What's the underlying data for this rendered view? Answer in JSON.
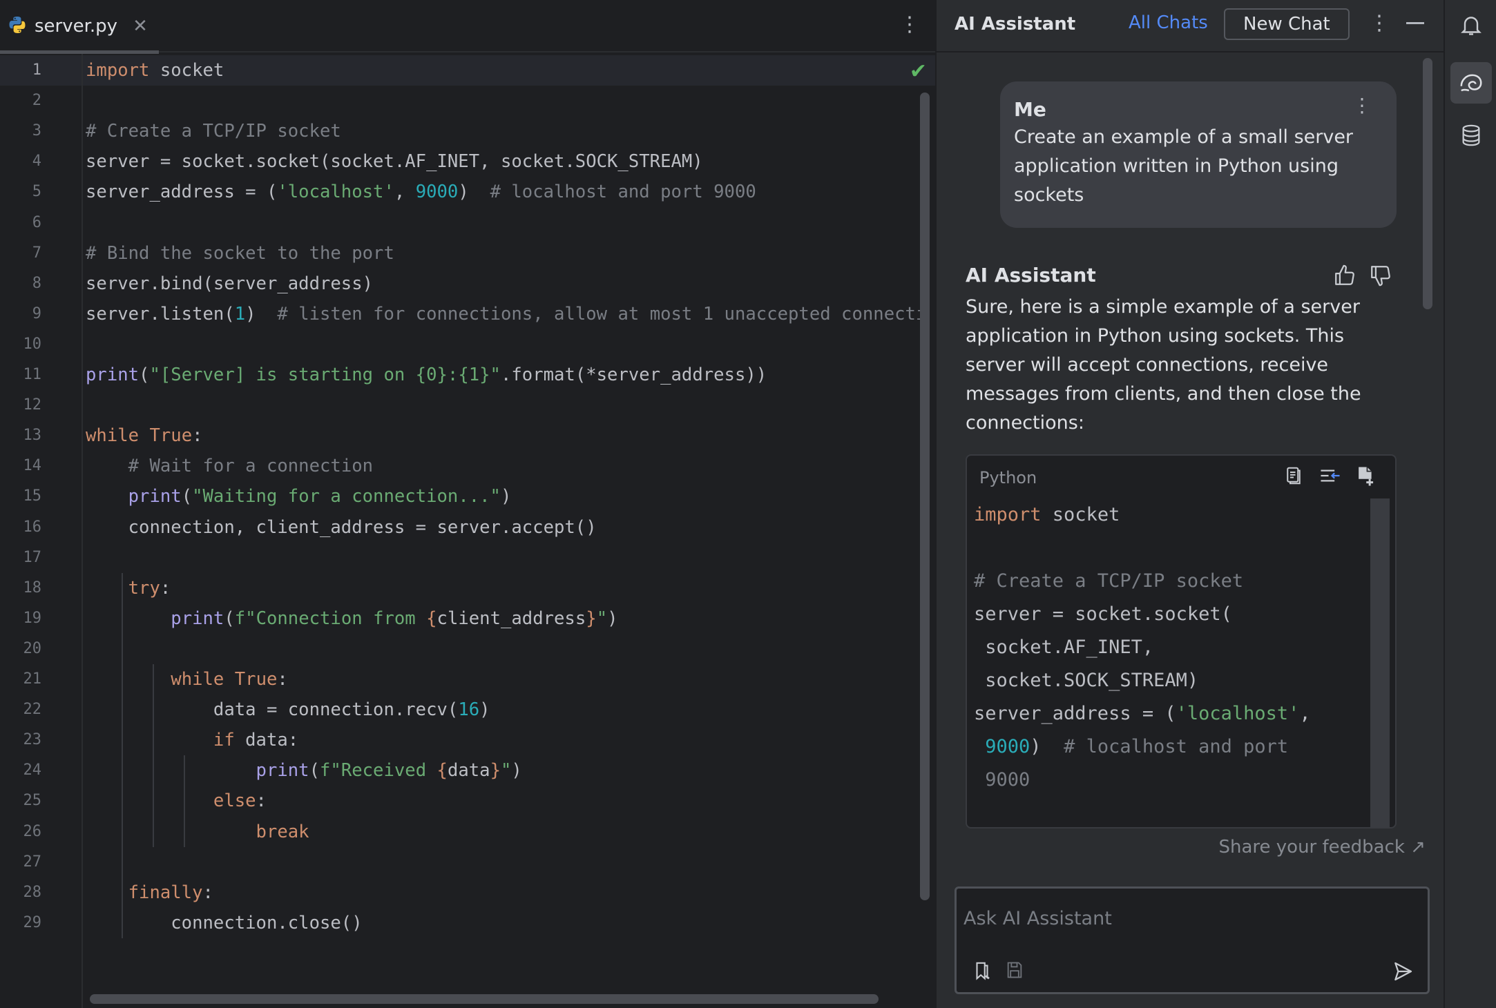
{
  "editor": {
    "tab": {
      "filename": "server.py",
      "close": "✕"
    },
    "menu_glyph": "⋮",
    "check_glyph": "✔",
    "current_line": "1",
    "lines": [
      {
        "n": "1",
        "tokens": [
          {
            "t": "import",
            "c": "kw"
          },
          {
            "t": " socket"
          }
        ]
      },
      {
        "n": "2",
        "tokens": []
      },
      {
        "n": "3",
        "tokens": [
          {
            "t": "# Create a TCP/IP socket",
            "c": "cm"
          }
        ]
      },
      {
        "n": "4",
        "tokens": [
          {
            "t": "server = socket.socket(socket.AF_INET, socket.SOCK_STREAM)"
          }
        ]
      },
      {
        "n": "5",
        "tokens": [
          {
            "t": "server_address = ("
          },
          {
            "t": "'localhost'",
            "c": "str"
          },
          {
            "t": ", "
          },
          {
            "t": "9000",
            "c": "num"
          },
          {
            "t": ")  "
          },
          {
            "t": "# localhost and port 9000",
            "c": "cm"
          }
        ]
      },
      {
        "n": "6",
        "tokens": []
      },
      {
        "n": "7",
        "tokens": [
          {
            "t": "# Bind the socket to the port",
            "c": "cm"
          }
        ]
      },
      {
        "n": "8",
        "tokens": [
          {
            "t": "server.bind(server_address)"
          }
        ]
      },
      {
        "n": "9",
        "tokens": [
          {
            "t": "server.listen("
          },
          {
            "t": "1",
            "c": "num"
          },
          {
            "t": ")  "
          },
          {
            "t": "# listen for connections, allow at most 1 unaccepted connecti",
            "c": "cm"
          }
        ]
      },
      {
        "n": "10",
        "tokens": []
      },
      {
        "n": "11",
        "tokens": [
          {
            "t": "print",
            "c": "bi"
          },
          {
            "t": "("
          },
          {
            "t": "\"[Server] is starting on {0}:{1}\"",
            "c": "str"
          },
          {
            "t": ".format(*server_address))"
          }
        ]
      },
      {
        "n": "12",
        "tokens": []
      },
      {
        "n": "13",
        "tokens": [
          {
            "t": "while",
            "c": "kw"
          },
          {
            "t": " "
          },
          {
            "t": "True",
            "c": "kw"
          },
          {
            "t": ":"
          }
        ]
      },
      {
        "n": "14",
        "tokens": [
          {
            "t": "    "
          },
          {
            "t": "# Wait for a connection",
            "c": "cm"
          }
        ]
      },
      {
        "n": "15",
        "tokens": [
          {
            "t": "    "
          },
          {
            "t": "print",
            "c": "bi"
          },
          {
            "t": "("
          },
          {
            "t": "\"Waiting for a connection...\"",
            "c": "str"
          },
          {
            "t": ")"
          }
        ]
      },
      {
        "n": "16",
        "tokens": [
          {
            "t": "    connection, client_address = server.accept()"
          }
        ]
      },
      {
        "n": "17",
        "tokens": []
      },
      {
        "n": "18",
        "tokens": [
          {
            "t": "    "
          },
          {
            "t": "try",
            "c": "kw"
          },
          {
            "t": ":"
          }
        ]
      },
      {
        "n": "19",
        "tokens": [
          {
            "t": "        "
          },
          {
            "t": "print",
            "c": "bi"
          },
          {
            "t": "("
          },
          {
            "t": "f\"Connection from ",
            "c": "str"
          },
          {
            "t": "{",
            "c": "kw"
          },
          {
            "t": "client_address"
          },
          {
            "t": "}",
            "c": "kw"
          },
          {
            "t": "\"",
            "c": "str"
          },
          {
            "t": ")"
          }
        ]
      },
      {
        "n": "20",
        "tokens": []
      },
      {
        "n": "21",
        "tokens": [
          {
            "t": "        "
          },
          {
            "t": "while",
            "c": "kw"
          },
          {
            "t": " "
          },
          {
            "t": "True",
            "c": "kw"
          },
          {
            "t": ":"
          }
        ]
      },
      {
        "n": "22",
        "tokens": [
          {
            "t": "            data = connection.recv("
          },
          {
            "t": "16",
            "c": "num"
          },
          {
            "t": ")"
          }
        ]
      },
      {
        "n": "23",
        "tokens": [
          {
            "t": "            "
          },
          {
            "t": "if",
            "c": "kw"
          },
          {
            "t": " data:"
          }
        ]
      },
      {
        "n": "24",
        "tokens": [
          {
            "t": "                "
          },
          {
            "t": "print",
            "c": "bi"
          },
          {
            "t": "("
          },
          {
            "t": "f\"Received ",
            "c": "str"
          },
          {
            "t": "{",
            "c": "kw"
          },
          {
            "t": "data"
          },
          {
            "t": "}",
            "c": "kw"
          },
          {
            "t": "\"",
            "c": "str"
          },
          {
            "t": ")"
          }
        ]
      },
      {
        "n": "25",
        "tokens": [
          {
            "t": "            "
          },
          {
            "t": "else",
            "c": "kw"
          },
          {
            "t": ":"
          }
        ]
      },
      {
        "n": "26",
        "tokens": [
          {
            "t": "                "
          },
          {
            "t": "break",
            "c": "kw"
          }
        ]
      },
      {
        "n": "27",
        "tokens": []
      },
      {
        "n": "28",
        "tokens": [
          {
            "t": "    "
          },
          {
            "t": "finally",
            "c": "kw"
          },
          {
            "t": ":"
          }
        ]
      },
      {
        "n": "29",
        "tokens": [
          {
            "t": "        connection.close()"
          }
        ]
      }
    ]
  },
  "ai": {
    "title": "AI Assistant",
    "all_chats": "All Chats",
    "new_chat": "New Chat",
    "menu_glyph": "⋮",
    "me": {
      "name": "Me",
      "text": "Create an example of a small server application written in Python using sockets"
    },
    "response": {
      "name": "AI Assistant",
      "text": "Sure, here is a simple example of a server application in Python using sockets. This server will accept connections, receive messages from clients, and then close the connections:"
    },
    "code_block": {
      "language": "Python",
      "lines": [
        [
          {
            "t": "import",
            "c": "kw"
          },
          {
            "t": " socket"
          }
        ],
        [],
        [
          {
            "t": "# Create a TCP/IP socket",
            "c": "cm"
          }
        ],
        [
          {
            "t": "server = socket.socket("
          }
        ],
        [
          {
            "t": " socket.AF_INET,"
          }
        ],
        [
          {
            "t": " socket.SOCK_STREAM)"
          }
        ],
        [
          {
            "t": "server_address = ("
          },
          {
            "t": "'localhost'",
            "c": "str"
          },
          {
            "t": ","
          }
        ],
        [
          {
            "t": " "
          },
          {
            "t": "9000",
            "c": "num"
          },
          {
            "t": ")  "
          },
          {
            "t": "# localhost and port",
            "c": "cm"
          }
        ],
        [
          {
            "t": " 9000",
            "c": "cm"
          }
        ]
      ]
    },
    "feedback": "Share your feedback ↗",
    "input_placeholder": "Ask AI Assistant"
  },
  "colors": {
    "bg": "#1e1f22",
    "panel": "#2b2d30",
    "keyword": "#cf8e6d",
    "string": "#6aab73",
    "number": "#2aacb8",
    "comment": "#7a7e85",
    "builtin": "#a9a1e8",
    "link": "#548af7"
  },
  "icons": [
    "python-file-icon",
    "close-icon",
    "more-vertical-icon",
    "check-icon",
    "thumbs-up-icon",
    "thumbs-down-icon",
    "copy-icon",
    "insert-at-caret-icon",
    "new-file-icon",
    "bookmark-icon",
    "save-icon",
    "send-icon",
    "bell-icon",
    "ai-assistant-spiral-icon",
    "database-icon",
    "minimize-icon"
  ]
}
